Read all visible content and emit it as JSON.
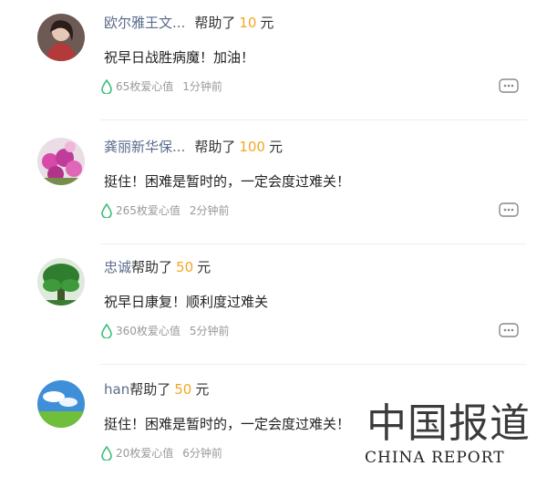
{
  "comments": [
    {
      "name": "欧尔雅王文...",
      "helped": "帮助了",
      "amount": "10",
      "unit": "元",
      "text": "祝早日战胜病魔！加油！",
      "love": "65枚爱心值",
      "time": "1分钟前",
      "avatar": "woman-portrait-avatar"
    },
    {
      "name": "龚丽新华保...",
      "helped": "帮助了",
      "amount": "100",
      "unit": "元",
      "text": "挺住！困难是暂时的，一定会度过难关！",
      "love": "265枚爱心值",
      "time": "2分钟前",
      "avatar": "flower-avatar"
    },
    {
      "name": "忠诚",
      "helped": "帮助了",
      "amount": "50",
      "unit": "元",
      "text": "祝早日康复！顺利度过难关",
      "love": "360枚爱心值",
      "time": "5分钟前",
      "avatar": "tree-avatar"
    },
    {
      "name": "han",
      "helped": "帮助了",
      "amount": "50",
      "unit": "元",
      "text": "挺住！困难是暂时的，一定会度过难关！",
      "love": "20枚爱心值",
      "time": "6分钟前",
      "avatar": "sky-landscape-avatar"
    }
  ],
  "watermark": {
    "cn": "中国报道",
    "en": "CHINA REPORT"
  },
  "colors": {
    "name": "#5a6b8c",
    "amount": "#f5a623",
    "drop": "#3cc07a",
    "meta": "#999999"
  }
}
